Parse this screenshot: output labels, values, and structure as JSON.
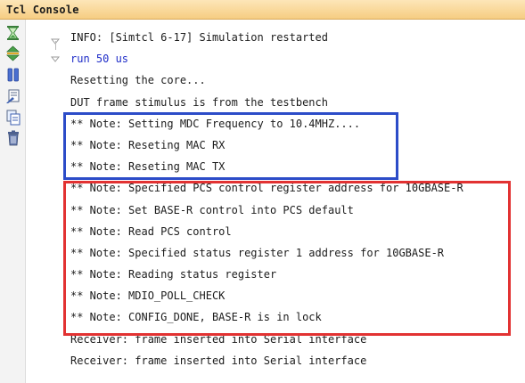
{
  "panel": {
    "title": "Tcl Console"
  },
  "toolbar": {
    "buttons": [
      {
        "icon": "hourglass-icon"
      },
      {
        "icon": "scroll-updown-icon"
      },
      {
        "icon": "pause-icon"
      },
      {
        "icon": "clear-console-icon"
      },
      {
        "icon": "copy-icon"
      },
      {
        "icon": "trash-icon"
      }
    ]
  },
  "console": {
    "lines": [
      {
        "text": "INFO: [Simtcl 6-17] Simulation restarted",
        "kind": "info"
      },
      {
        "text": "run 50 us",
        "kind": "command"
      },
      {
        "text": "Resetting the core...",
        "kind": "output"
      },
      {
        "text": "DUT frame stimulus is from the testbench",
        "kind": "output"
      },
      {
        "text": "** Note: Setting MDC Frequency to 10.4MHZ....",
        "kind": "output"
      },
      {
        "text": "** Note: Reseting MAC RX",
        "kind": "output"
      },
      {
        "text": "** Note: Reseting MAC TX",
        "kind": "output"
      },
      {
        "text": "** Note: Specified PCS control register address for 10GBASE-R",
        "kind": "output"
      },
      {
        "text": "** Note: Set BASE-R control into PCS default",
        "kind": "output"
      },
      {
        "text": "** Note: Read PCS control",
        "kind": "output"
      },
      {
        "text": "** Note: Specified status register 1 address for 10GBASE-R",
        "kind": "output"
      },
      {
        "text": "** Note: Reading status register",
        "kind": "output"
      },
      {
        "text": "** Note: MDIO_POLL_CHECK",
        "kind": "output"
      },
      {
        "text": "** Note: CONFIG_DONE, BASE-R is in lock",
        "kind": "output"
      },
      {
        "text": "Receiver: frame inserted into Serial interface",
        "kind": "output"
      },
      {
        "text": "Receiver: frame inserted into Serial interface",
        "kind": "output"
      }
    ]
  },
  "highlights": {
    "blue_color": "#2c4cc8",
    "red_color": "#e23232"
  }
}
